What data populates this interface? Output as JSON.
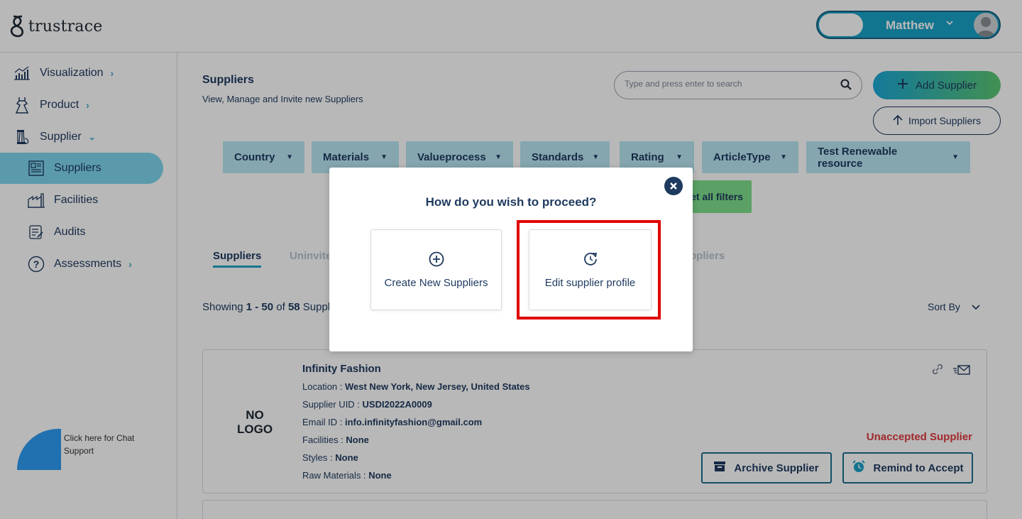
{
  "header": {
    "logo_text": "trustrace",
    "user_name": "Matthew"
  },
  "sidebar": {
    "items": [
      {
        "label": "Visualization",
        "icon": "chart-icon",
        "has_arrow": true
      },
      {
        "label": "Product",
        "icon": "dress-icon",
        "has_arrow": true
      },
      {
        "label": "Supplier",
        "icon": "thread-icon",
        "has_arrow": true
      },
      {
        "label": "Suppliers",
        "icon": "list-icon",
        "active": true
      },
      {
        "label": "Facilities",
        "icon": "factory-icon"
      },
      {
        "label": "Audits",
        "icon": "audit-icon"
      },
      {
        "label": "Assessments",
        "icon": "question-icon",
        "has_arrow": true
      }
    ],
    "chat_text": "Click here for Chat Support"
  },
  "main": {
    "title": "Suppliers",
    "subtitle": "View, Manage and Invite new Suppliers",
    "search_placeholder": "Type and press enter to search",
    "add_label": "Add Supplier",
    "import_label": "Import Suppliers",
    "filters": [
      "Country",
      "Materials",
      "Valueprocess",
      "Standards",
      "Rating",
      "ArticleType",
      "Test Renewable resource"
    ],
    "reset_label": "Reset all filters",
    "reset_visible": "et all filters",
    "tabs": [
      "Suppliers",
      "Uninvite",
      "ppliers"
    ],
    "showing": {
      "prefix": "Showing ",
      "range": "1 - 50",
      "of": " of ",
      "total": "58",
      "suffix": " Suppli"
    },
    "sort_by": "Sort By"
  },
  "supplier_card": {
    "no_logo_1": "NO",
    "no_logo_2": "LOGO",
    "name": "Infinity Fashion",
    "location_label": "Location : ",
    "location": "West New York, New Jersey, United States",
    "uid_label": "Supplier UID : ",
    "uid": "USDI2022A0009",
    "email_label": "Email ID : ",
    "email": "info.infinityfashion@gmail.com",
    "facilities_label": "Facilities : ",
    "facilities": "None",
    "styles_label": "Styles : ",
    "styles": "None",
    "raw_label": "Raw Materials : ",
    "raw": "None",
    "status": "Unaccepted Supplier",
    "archive_label": "Archive Supplier",
    "remind_label": "Remind to Accept"
  },
  "modal": {
    "title": "How do you wish to proceed?",
    "option_create": "Create New Suppliers",
    "option_edit": "Edit supplier profile"
  },
  "colors": {
    "accent": "#1aa3c7",
    "navy": "#1e3a5f",
    "filter_bg": "#b9e6f3",
    "danger": "#e0393e",
    "highlight": "#e00000"
  }
}
